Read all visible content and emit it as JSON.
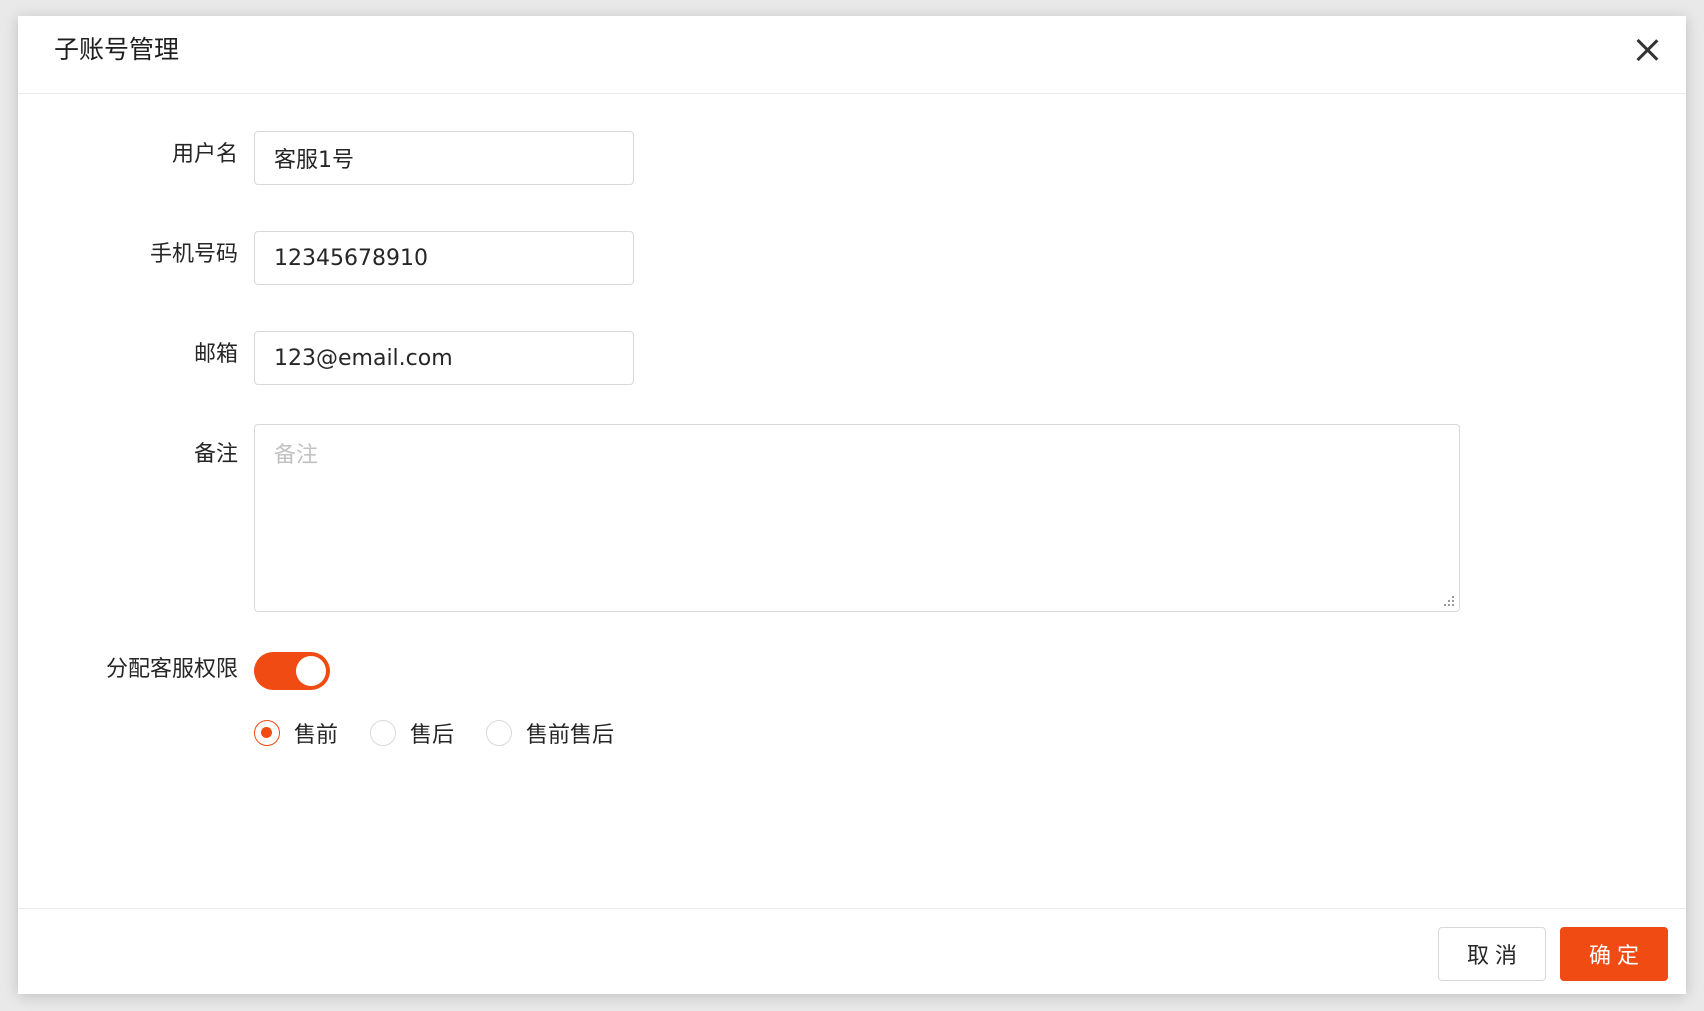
{
  "dialog": {
    "title": "子账号管理"
  },
  "form": {
    "username": {
      "label": "用户名",
      "value": "客服1号"
    },
    "phone": {
      "label": "手机号码",
      "value": "12345678910"
    },
    "email": {
      "label": "邮箱",
      "value": "123@email.com"
    },
    "remark": {
      "label": "备注",
      "value": "",
      "placeholder": "备注"
    },
    "permission": {
      "label": "分配客服权限",
      "enabled": true,
      "options": [
        {
          "label": "售前",
          "checked": true
        },
        {
          "label": "售后",
          "checked": false
        },
        {
          "label": "售前售后",
          "checked": false
        }
      ]
    }
  },
  "footer": {
    "cancel_label": "取消",
    "ok_label": "确定"
  },
  "colors": {
    "accent": "#f04b12"
  }
}
